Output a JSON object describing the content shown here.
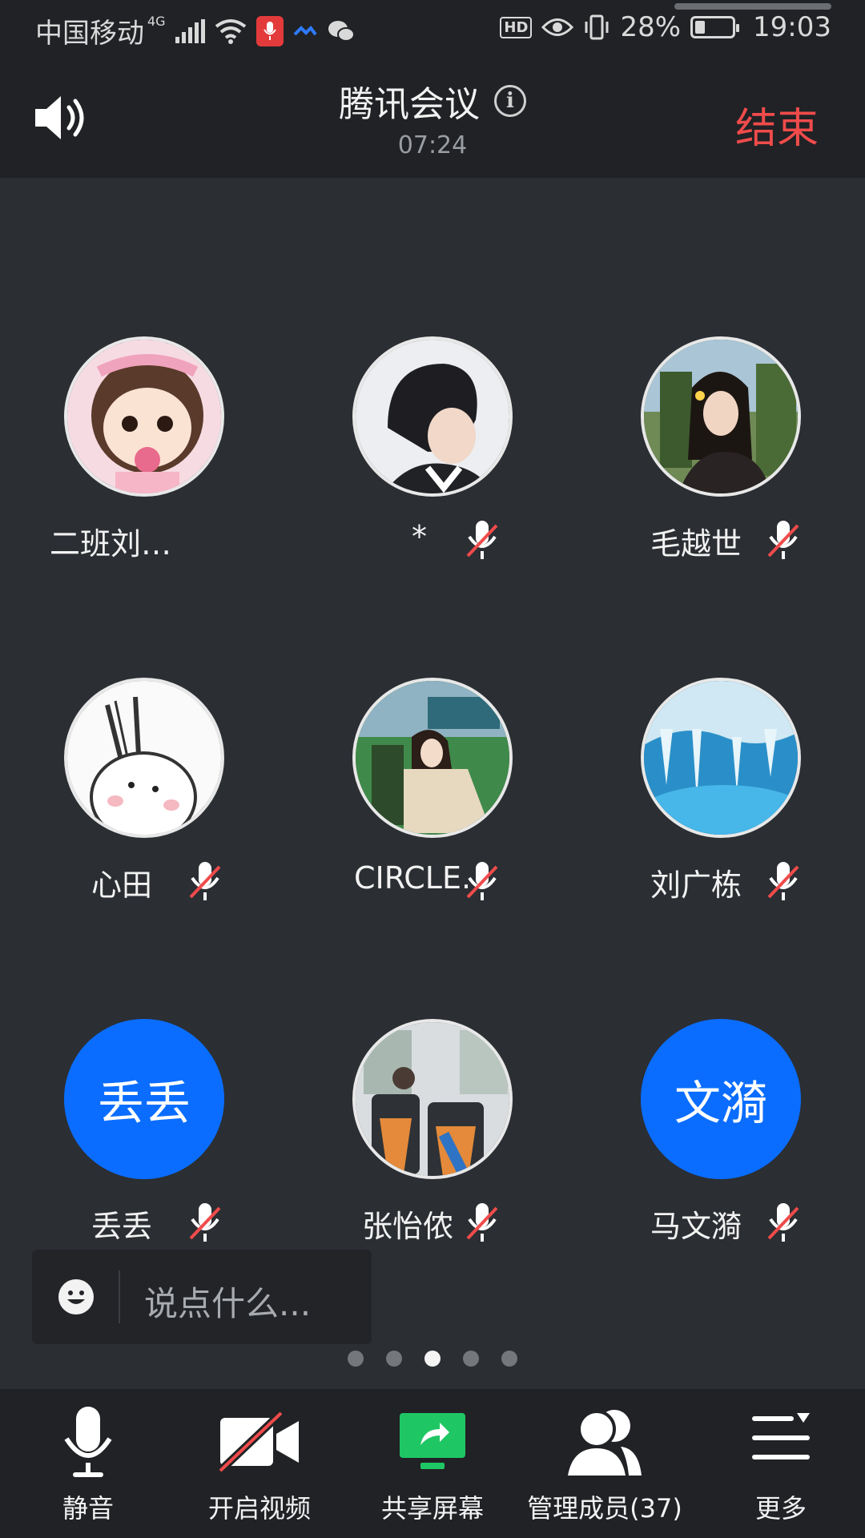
{
  "status_bar": {
    "carrier": "中国移动",
    "network": "4G",
    "battery_text": "28%",
    "battery_level": 0.28,
    "time": "19:03",
    "hd_label": "HD"
  },
  "header": {
    "title": "腾讯会议",
    "timer": "07:24",
    "end_label": "结束"
  },
  "participants": [
    {
      "name": "二班刘…",
      "muted": false,
      "avatar": "cartoon-girl-photo"
    },
    {
      "name": "*",
      "muted": true,
      "avatar": "boy-back-photo"
    },
    {
      "name": "毛越世",
      "muted": true,
      "avatar": "girl-outdoor-photo"
    },
    {
      "name": "心田",
      "muted": true,
      "avatar": "bunny-cartoon-photo"
    },
    {
      "name": "CIRCLE.",
      "muted": true,
      "avatar": "girl-sitting-photo"
    },
    {
      "name": "刘广栋",
      "muted": true,
      "avatar": "ice-cave-photo"
    },
    {
      "name": "丢丢",
      "muted": true,
      "avatar_text": "丢丢"
    },
    {
      "name": "张怡侬",
      "muted": true,
      "avatar": "bus-seats-photo"
    },
    {
      "name": "马文漪",
      "muted": true,
      "avatar_text": "文漪"
    }
  ],
  "chat": {
    "placeholder": "说点什么..."
  },
  "pagination": {
    "total": 5,
    "current": 3
  },
  "toolbar": {
    "mute_label": "静音",
    "video_label": "开启视频",
    "share_label": "共享屏幕",
    "members_label": "管理成员(37)",
    "more_label": "更多"
  },
  "colors": {
    "accent_blue": "#0a6dff",
    "end_red": "#f04b4b",
    "share_green": "#1fc764",
    "background": "#2b2e33",
    "bar_background": "#202225"
  }
}
